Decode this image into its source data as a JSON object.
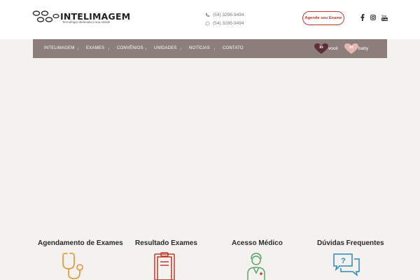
{
  "header": {
    "logo": {
      "name": "INTELIMAGEM",
      "tagline": "Tecnologia dedicada à sua saúde"
    },
    "phones": [
      {
        "icon": "phone-icon",
        "number": "(54) 3295-9494"
      },
      {
        "icon": "whatsapp-icon",
        "number": "(54) 3295-9494"
      }
    ],
    "cta_label": "Agende seu Exame",
    "social": [
      "facebook-icon",
      "instagram-icon",
      "youtube-icon"
    ]
  },
  "nav": {
    "items": [
      "INTELIMAGEM",
      "EXAMES",
      "CONVÊNIOS",
      "UNIDADES",
      "NOTÍCIAS",
      "CONTATO"
    ],
    "badges": [
      {
        "heart_text": "in",
        "word": "você",
        "color": "#5c2f36"
      },
      {
        "heart_text": "in",
        "word": "baby",
        "color": "#e6b6b0"
      }
    ]
  },
  "services": [
    {
      "title": "Agendamento de Exames",
      "icon": "stethoscope-icon",
      "color": "#e8912f"
    },
    {
      "title": "Resultado Exames",
      "icon": "clipboard-icon",
      "color": "#c0392b"
    },
    {
      "title": "Acesso Médico",
      "icon": "doctor-icon",
      "color": "#5aa469"
    },
    {
      "title": "Dúvidas Frequentes",
      "icon": "chat-question-icon",
      "color": "#2e86c1"
    }
  ]
}
